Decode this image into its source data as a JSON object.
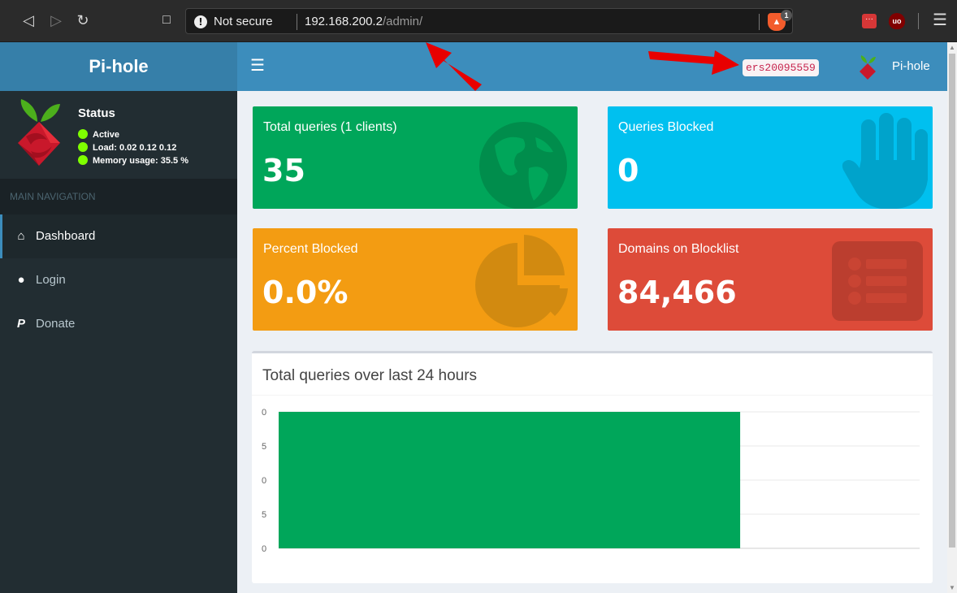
{
  "browser": {
    "security_label": "Not secure",
    "url_host": "192.168.200.2",
    "url_path": "/admin/",
    "shield_count": "1"
  },
  "sidebar": {
    "app_name": "Pi-hole",
    "status": {
      "title": "Status",
      "items": [
        "Active",
        "Load:  0.02  0.12  0.12",
        "Memory usage:  35.5 %"
      ]
    },
    "nav_header": "MAIN NAVIGATION",
    "items": [
      {
        "label": "Dashboard",
        "icon": "home-icon",
        "active": true
      },
      {
        "label": "Login",
        "icon": "user-icon",
        "active": false
      },
      {
        "label": "Donate",
        "icon": "paypal-icon",
        "active": false
      }
    ]
  },
  "topbar": {
    "hostname": "ers20095559",
    "user_label": "Pi-hole"
  },
  "stats": [
    {
      "label": "Total queries (1 clients)",
      "value": "35",
      "color": "#00a65a",
      "icon": "globe-icon"
    },
    {
      "label": "Queries Blocked",
      "value": "0",
      "color": "#00c0ef",
      "icon": "hand-icon"
    },
    {
      "label": "Percent Blocked",
      "value": "0.0%",
      "color": "#f39c12",
      "icon": "pie-chart-icon"
    },
    {
      "label": "Domains on Blocklist",
      "value": "84,466",
      "color": "#dd4b39",
      "icon": "list-icon"
    }
  ],
  "chart_panel": {
    "title": "Total queries over last 24 hours"
  },
  "chart_data": {
    "type": "bar",
    "title": "Total queries over last 24 hours",
    "y_tick_labels": [
      "0",
      "5",
      "0",
      "5",
      "0"
    ],
    "series": [
      {
        "color": "#00a65a",
        "bar_extent_fraction": 0.72,
        "fills_to_top": true
      }
    ],
    "grid": true
  }
}
